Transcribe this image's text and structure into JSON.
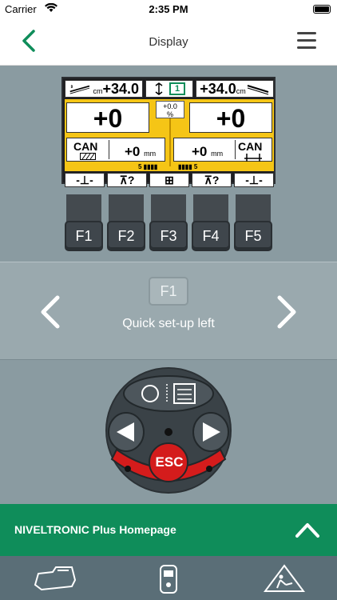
{
  "status": {
    "carrier": "Carrier",
    "time": "2:35 PM"
  },
  "nav": {
    "title": "Display"
  },
  "display": {
    "top_left": {
      "unit": "cm",
      "value": "+34.0"
    },
    "top_center": {
      "value": "1"
    },
    "top_right": {
      "value": "+34.0",
      "unit": "cm"
    },
    "left_big": "+0",
    "right_big": "+0",
    "center_pct": {
      "value": "+0.0",
      "unit": "%"
    },
    "left_can": {
      "label": "CAN",
      "value": "+0",
      "unit": "mm",
      "count": "5"
    },
    "right_can": {
      "label": "CAN",
      "value": "+0",
      "unit": "mm",
      "count": "5"
    },
    "bottom_buttons": [
      "‑⊥‑",
      "⊼?",
      "⊞",
      "⊼?",
      "‑⊥‑"
    ]
  },
  "fkeys": [
    "F1",
    "F2",
    "F3",
    "F4",
    "F5"
  ],
  "middle": {
    "key": "F1",
    "label": "Quick set-up left"
  },
  "keypad": {
    "esc": "ESC"
  },
  "footer": {
    "label": "NIVELTRONIC Plus Homepage"
  },
  "colors": {
    "green": "#0f8d5a",
    "yellow": "#f5c516",
    "red": "#d41c1c"
  }
}
